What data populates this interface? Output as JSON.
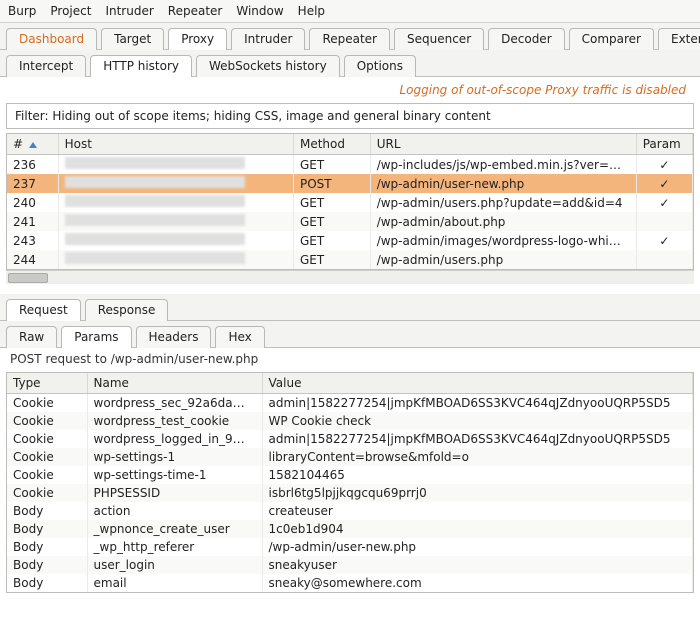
{
  "menubar": {
    "items": [
      "Burp",
      "Project",
      "Intruder",
      "Repeater",
      "Window",
      "Help"
    ]
  },
  "mainTabs": {
    "items": [
      "Dashboard",
      "Target",
      "Proxy",
      "Intruder",
      "Repeater",
      "Sequencer",
      "Decoder",
      "Comparer",
      "Extende"
    ],
    "activeIndex": 2,
    "accentIndex": 0
  },
  "proxyTabs": {
    "items": [
      "Intercept",
      "HTTP history",
      "WebSockets history",
      "Options"
    ],
    "activeIndex": 1
  },
  "statusMessage": "Logging of out-of-scope Proxy traffic is disabled",
  "filterText": "Filter: Hiding out of scope items;  hiding CSS, image and general binary content",
  "history": {
    "columns": [
      "#",
      "Host",
      "Method",
      "URL",
      "Param"
    ],
    "sortedCol": 0,
    "rows": [
      {
        "num": "236",
        "method": "GET",
        "url": "/wp-includes/js/wp-embed.min.js?ver=…",
        "param": true,
        "selected": false
      },
      {
        "num": "237",
        "method": "POST",
        "url": "/wp-admin/user-new.php",
        "param": true,
        "selected": true
      },
      {
        "num": "240",
        "method": "GET",
        "url": "/wp-admin/users.php?update=add&id=4",
        "param": true,
        "selected": false
      },
      {
        "num": "241",
        "method": "GET",
        "url": "/wp-admin/about.php",
        "param": false,
        "selected": false
      },
      {
        "num": "243",
        "method": "GET",
        "url": "/wp-admin/images/wordpress-logo-whi…",
        "param": true,
        "selected": false
      },
      {
        "num": "244",
        "method": "GET",
        "url": "/wp-admin/users.php",
        "param": false,
        "selected": false
      }
    ]
  },
  "reqRespTabs": {
    "items": [
      "Request",
      "Response"
    ],
    "activeIndex": 0
  },
  "viewTabs": {
    "items": [
      "Raw",
      "Params",
      "Headers",
      "Hex"
    ],
    "activeIndex": 1
  },
  "requestDesc": "POST request to /wp-admin/user-new.php",
  "params": {
    "columns": [
      "Type",
      "Name",
      "Value"
    ],
    "rows": [
      {
        "type": "Cookie",
        "name": "wordpress_sec_92a6da…",
        "value": "admin|1582277254|jmpKfMBOAD6SS3KVC464qJZdnyooUQRP5SD5"
      },
      {
        "type": "Cookie",
        "name": "wordpress_test_cookie",
        "value": "WP Cookie check"
      },
      {
        "type": "Cookie",
        "name": "wordpress_logged_in_9…",
        "value": "admin|1582277254|jmpKfMBOAD6SS3KVC464qJZdnyooUQRP5SD5"
      },
      {
        "type": "Cookie",
        "name": "wp-settings-1",
        "value": "libraryContent=browse&mfold=o"
      },
      {
        "type": "Cookie",
        "name": "wp-settings-time-1",
        "value": "1582104465"
      },
      {
        "type": "Cookie",
        "name": "PHPSESSID",
        "value": "isbrl6tg5lpjjkqgcqu69prrj0"
      },
      {
        "type": "Body",
        "name": "action",
        "value": "createuser"
      },
      {
        "type": "Body",
        "name": "_wpnonce_create_user",
        "value": "1c0eb1d904"
      },
      {
        "type": "Body",
        "name": "_wp_http_referer",
        "value": "/wp-admin/user-new.php"
      },
      {
        "type": "Body",
        "name": "user_login",
        "value": "sneakyuser"
      },
      {
        "type": "Body",
        "name": "email",
        "value": "sneaky@somewhere.com"
      }
    ]
  }
}
